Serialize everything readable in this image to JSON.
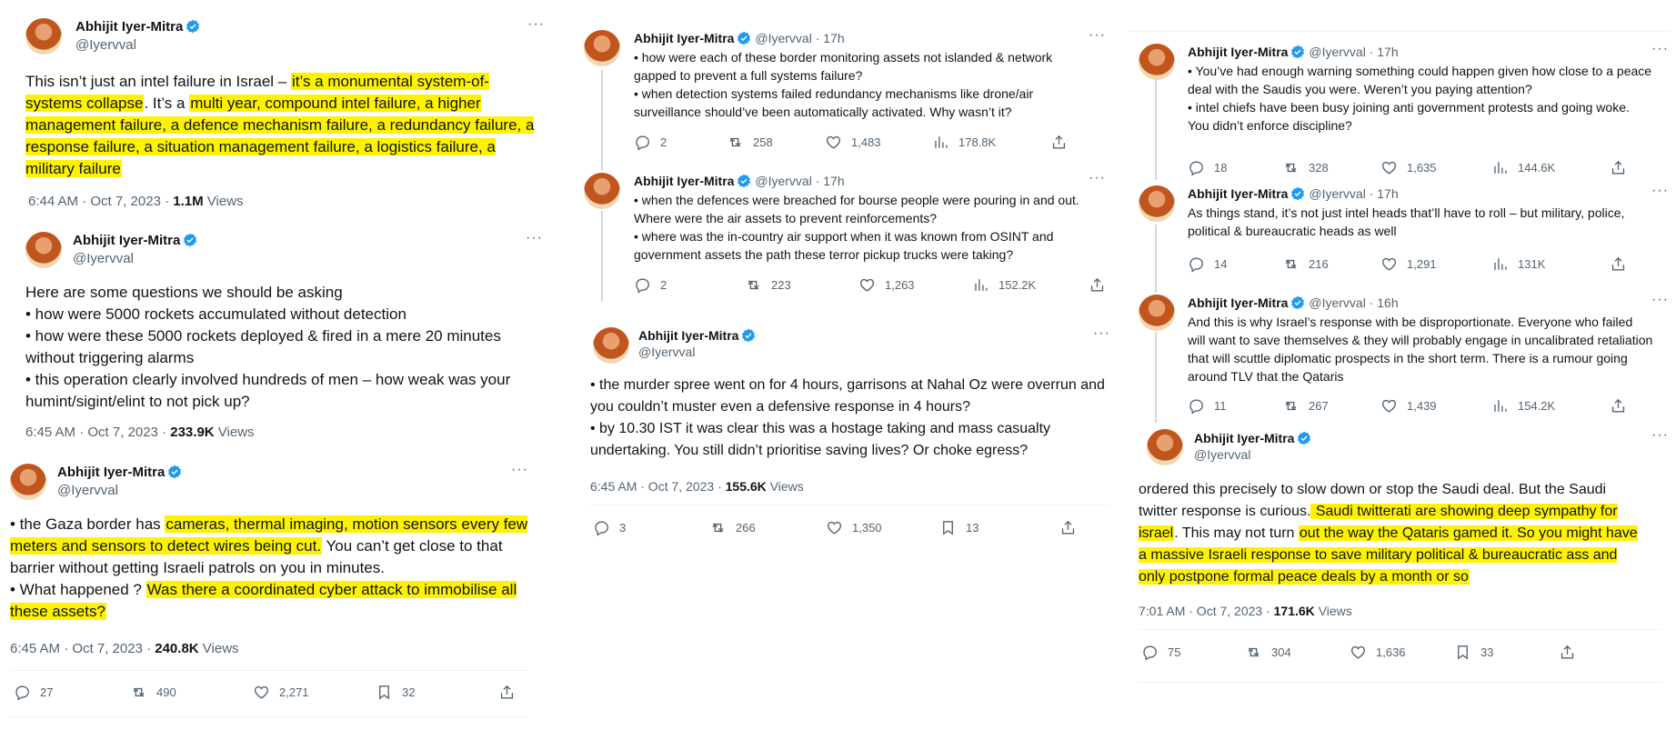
{
  "author": {
    "name": "Abhijit Iyer-Mitra",
    "handle": "@Iyervval"
  },
  "dot": "·",
  "more": "···",
  "views_label": "Views",
  "left": {
    "t1": {
      "parts": [
        {
          "text": "This isn’t just an intel failure in Israel – ",
          "hl": false
        },
        {
          "text": "it’s a monumental system-of-systems collapse",
          "hl": true
        },
        {
          "text": ". It’s a ",
          "hl": false
        },
        {
          "text": "multi year, compound intel failure, a higher management failure, a defence mechanism failure, a redundancy failure, a response failure, a situation management failure, a logistics failure, a military failure",
          "hl": true
        }
      ],
      "time": "6:44 AM · Oct 7, 2023 · ",
      "views": "1.1M"
    },
    "t2": {
      "lines": [
        "Here are some questions we should be asking",
        "• how were 5000 rockets accumulated without detection",
        "• how were these 5000 rockets deployed & fired in a mere 20 minutes without triggering alarms",
        "• this operation clearly involved hundreds of men – how weak was your humint/sigint/elint to not pick up?"
      ],
      "time": "6:45 AM · Oct 7, 2023 · ",
      "views": "233.9K"
    },
    "t3": {
      "parts": [
        {
          "text": "• the Gaza border has ",
          "hl": false
        },
        {
          "text": "cameras, thermal imaging, motion sensors every few meters and sensors to detect wires being cut.",
          "hl": true
        },
        {
          "text": " You can’t get close to that barrier without getting Israeli patrols on you in minutes.",
          "hl": false
        },
        {
          "br": true
        },
        {
          "text": "• What happened ? ",
          "hl": false
        },
        {
          "text": "Was there a coordinated cyber attack to immobilise all these assets?",
          "hl": true
        }
      ],
      "time": "6:45 AM · Oct 7, 2023 · ",
      "views": "240.8K",
      "replies": "27",
      "reposts": "490",
      "likes": "2,271",
      "bookmarks": "32"
    }
  },
  "middle": {
    "t1": {
      "time": "17h",
      "lines": [
        "• how were each of these border monitoring assets not islanded & network gapped to prevent a full systems failure?",
        "• when detection systems failed redundancy mechanisms like drone/air surveillance should’ve been automatically activated. Why wasn’t it?"
      ],
      "replies": "2",
      "reposts": "258",
      "likes": "1,483",
      "views": "178.8K"
    },
    "t2": {
      "time": "17h",
      "lines": [
        "• when the defences were breached for bourse people were pouring in and out. Where were the air assets to prevent reinforcements?",
        "• where was the in-country air support when it was known from OSINT and government assets the path these terror pickup trucks were taking?"
      ],
      "replies": "2",
      "reposts": "223",
      "likes": "1,263",
      "views": "152.2K"
    },
    "t3": {
      "lines": [
        "• the murder spree went on for 4 hours, garrisons at Nahal Oz were overrun and you couldn’t muster even a defensive response in 4 hours?",
        "• by 10.30 IST it was clear this was a hostage taking and mass casualty undertaking. You still didn’t prioritise saving lives? Or choke egress?"
      ],
      "time": "6:45 AM · Oct 7, 2023 · ",
      "views": "155.6K",
      "replies": "3",
      "reposts": "266",
      "likes": "1,350",
      "bookmarks": "13"
    }
  },
  "right": {
    "t1": {
      "time": "17h",
      "lines": [
        "• You’ve had enough warning something could happen given how close to a peace deal with the Saudis you were. Weren’t you paying attention?",
        "• intel chiefs have been busy joining anti government protests and going woke. You didn’t enforce discipline?"
      ],
      "replies": "18",
      "reposts": "328",
      "likes": "1,635",
      "views": "144.6K"
    },
    "t2": {
      "time": "17h",
      "lines": [
        "As things stand, it’s not just intel heads that’ll have to roll – but military, police, political & bureaucratic heads as well"
      ],
      "replies": "14",
      "reposts": "216",
      "likes": "1,291",
      "views": "131K"
    },
    "t3": {
      "time": "16h",
      "lines": [
        "And this is why Israel’s response with be disproportionate. Everyone who failed will want to save themselves & they will probably engage in uncalibrated retaliation that will scuttle diplomatic prospects in the short term. There is a rumour going around TLV that the Qataris"
      ],
      "replies": "11",
      "reposts": "267",
      "likes": "1,439",
      "views": "154.2K"
    },
    "t4": {
      "parts": [
        {
          "text": "ordered this precisely to slow down or stop the Saudi deal. But the Saudi twitter response is curious.",
          "hl": false
        },
        {
          "text": " Saudi twitterati are showing deep sympathy for israel",
          "hl": true
        },
        {
          "text": ". This may not turn ",
          "hl": false
        },
        {
          "text": "out the way the Qataris gamed it. So you might have a massive Israeli response to save military political & bureaucratic ass and only postpone formal peace deals by a month or so",
          "hl": true
        }
      ],
      "time": "7:01 AM · Oct 7, 2023 · ",
      "views": "171.6K",
      "replies": "75",
      "reposts": "304",
      "likes": "1,636",
      "bookmarks": "33"
    }
  }
}
